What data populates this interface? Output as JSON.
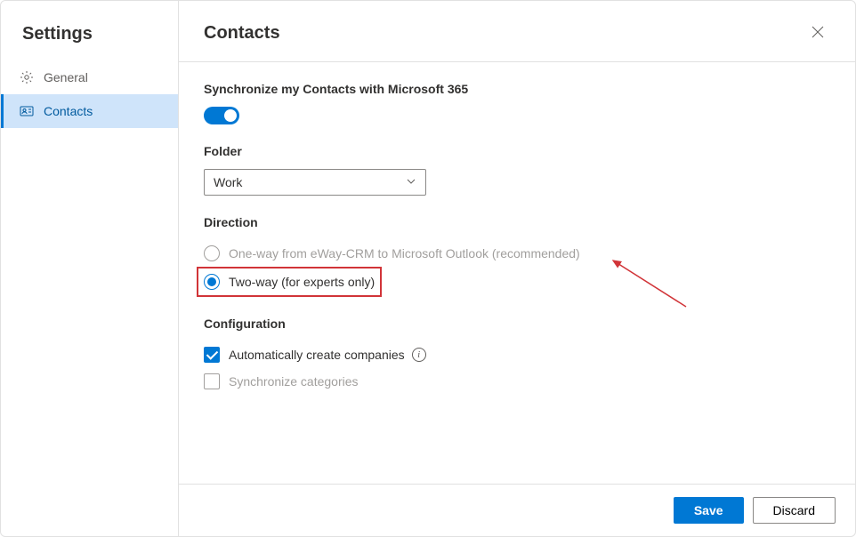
{
  "sidebar": {
    "title": "Settings",
    "items": [
      {
        "label": "General"
      },
      {
        "label": "Contacts"
      }
    ]
  },
  "page": {
    "title": "Contacts"
  },
  "sync": {
    "label": "Synchronize my Contacts with Microsoft 365",
    "toggle_on": true
  },
  "folder": {
    "label": "Folder",
    "value": "Work"
  },
  "direction": {
    "label": "Direction",
    "options": [
      {
        "label": "One-way from eWay-CRM to Microsoft Outlook (recommended)"
      },
      {
        "label": "Two-way (for experts only)"
      }
    ]
  },
  "configuration": {
    "label": "Configuration",
    "items": [
      {
        "label": "Automatically create companies"
      },
      {
        "label": "Synchronize categories"
      }
    ]
  },
  "buttons": {
    "save": "Save",
    "discard": "Discard"
  }
}
